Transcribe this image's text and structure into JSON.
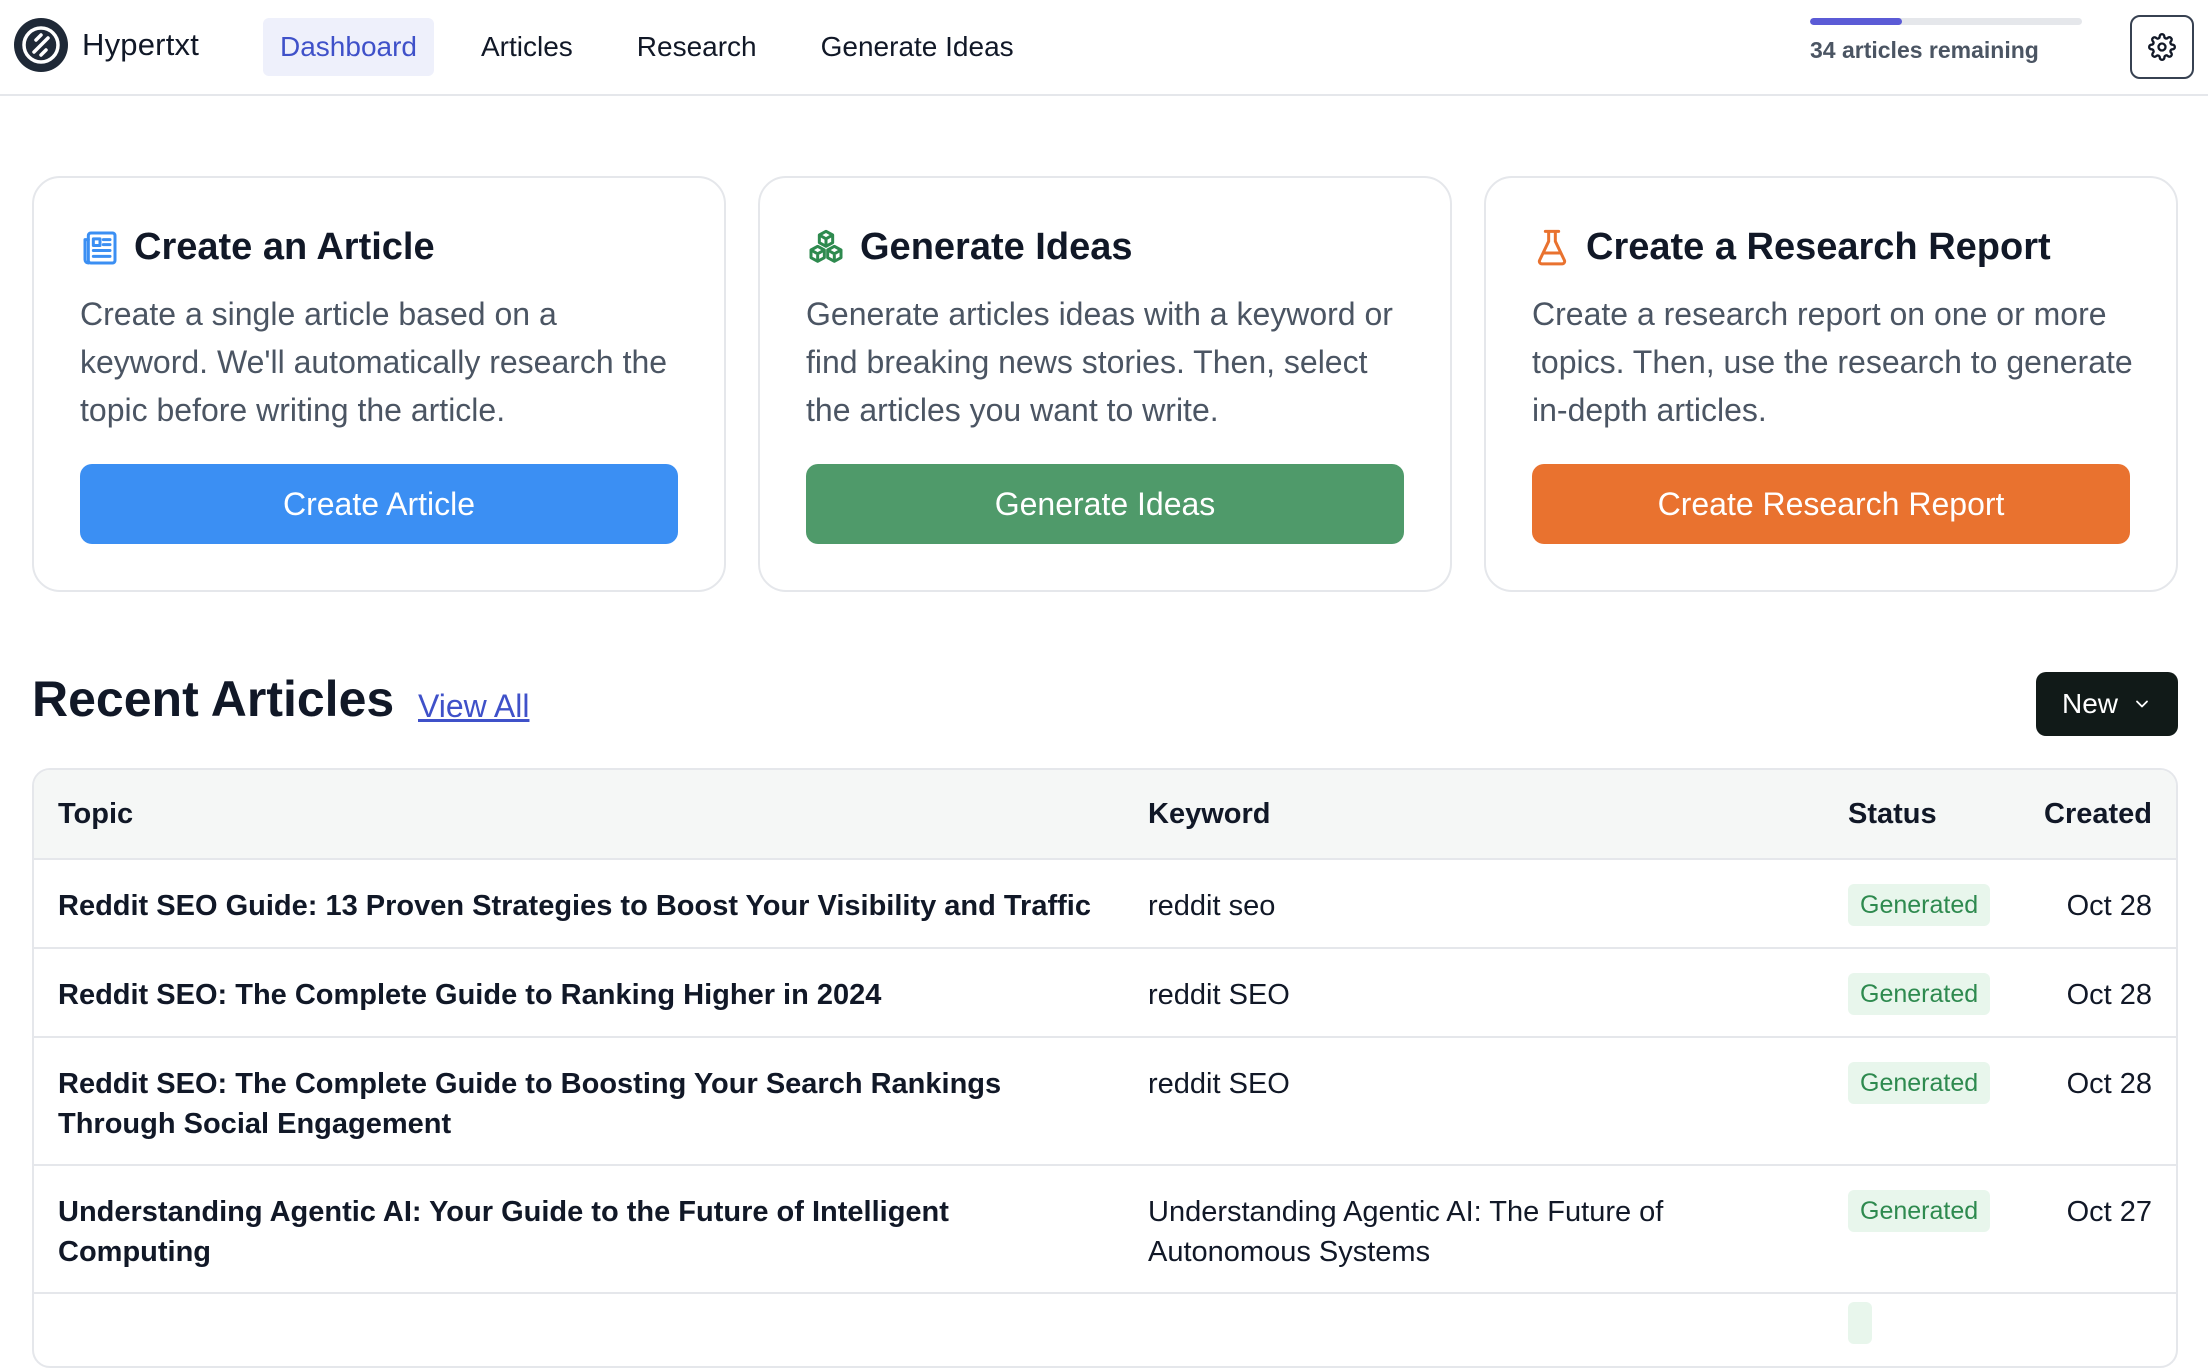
{
  "app": {
    "name": "Hypertxt"
  },
  "nav": {
    "items": [
      "Dashboard",
      "Articles",
      "Research",
      "Generate Ideas"
    ],
    "active": "Dashboard"
  },
  "quota": {
    "text": "34 articles remaining",
    "progress": 0.34
  },
  "cards": [
    {
      "title": "Create an Article",
      "description": "Create a single article based on a keyword. We'll automatically research the topic before writing the article.",
      "button": "Create Article",
      "icon": "newspaper-icon",
      "color": "#3b8ff3"
    },
    {
      "title": "Generate Ideas",
      "description": "Generate articles ideas with a keyword or find breaking news stories. Then, select the articles you want to write.",
      "button": "Generate Ideas",
      "icon": "cubes-icon",
      "color": "#4f9a6a"
    },
    {
      "title": "Create a Research Report",
      "description": "Create a research report on one or more topics. Then, use the research to generate in-depth articles.",
      "button": "Create Research Report",
      "icon": "flask-icon",
      "color": "#e9722f"
    }
  ],
  "recent": {
    "title": "Recent Articles",
    "view_all": "View All",
    "new_button": "New",
    "columns": [
      "Topic",
      "Keyword",
      "Status",
      "Created"
    ],
    "rows": [
      {
        "topic": "Reddit SEO Guide: 13 Proven Strategies to Boost Your Visibility and Traffic",
        "keyword": "reddit seo",
        "status": "Generated",
        "created": "Oct 28"
      },
      {
        "topic": "Reddit SEO: The Complete Guide to Ranking Higher in 2024",
        "keyword": "reddit SEO",
        "status": "Generated",
        "created": "Oct 28"
      },
      {
        "topic": "Reddit SEO: The Complete Guide to Boosting Your Search Rankings Through Social Engagement",
        "keyword": "reddit SEO",
        "status": "Generated",
        "created": "Oct 28"
      },
      {
        "topic": "Understanding Agentic AI: Your Guide to the Future of Intelligent Computing",
        "keyword": "Understanding Agentic AI: The Future of Autonomous Systems",
        "status": "Generated",
        "created": "Oct 27"
      }
    ]
  }
}
